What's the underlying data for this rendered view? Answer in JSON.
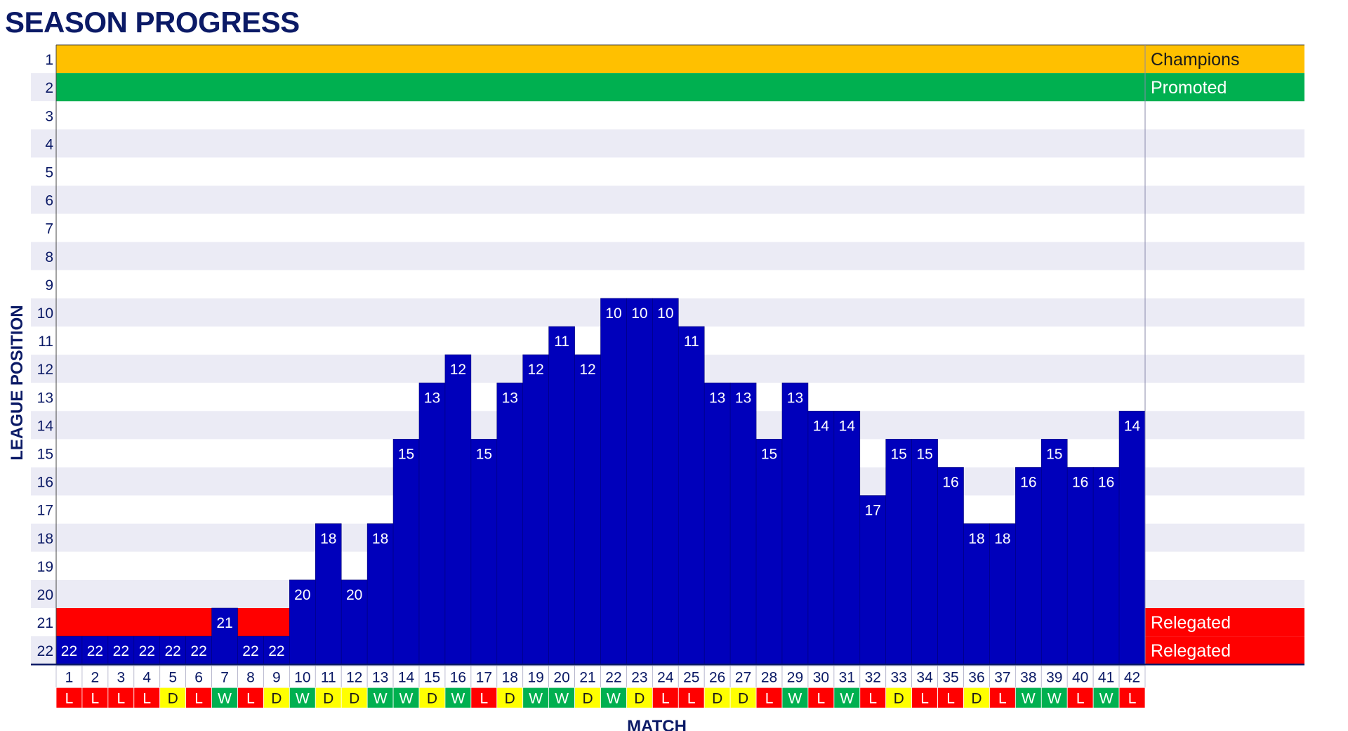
{
  "page": {
    "title": "SEASON PROGRESS"
  },
  "colors": {
    "title": "#0b1a66",
    "bar": "#0000bb",
    "stripe_light": "#ffffff",
    "stripe_dark": "#ebebf5",
    "champions": "#ffc000",
    "promoted": "#00b050",
    "relegated": "#ff0000",
    "result_W": "#00b050",
    "result_D": "#ffff00",
    "result_L": "#ff0000"
  },
  "chart_data": {
    "type": "bar",
    "title": "SEASON PROGRESS",
    "xlabel": "MATCH",
    "ylabel": "LEAGUE POSITION",
    "y_inverted": true,
    "ylim": [
      1,
      22
    ],
    "y_ticks": [
      "1",
      "2",
      "3",
      "4",
      "5",
      "6",
      "7",
      "8",
      "9",
      "10",
      "11",
      "12",
      "13",
      "14",
      "15",
      "16",
      "17",
      "18",
      "19",
      "20",
      "21",
      "22"
    ],
    "categories": [
      "1",
      "2",
      "3",
      "4",
      "5",
      "6",
      "7",
      "8",
      "9",
      "10",
      "11",
      "12",
      "13",
      "14",
      "15",
      "16",
      "17",
      "18",
      "19",
      "20",
      "21",
      "22",
      "23",
      "24",
      "25",
      "26",
      "27",
      "28",
      "29",
      "30",
      "31",
      "32",
      "33",
      "34",
      "35",
      "36",
      "37",
      "38",
      "39",
      "40",
      "41",
      "42"
    ],
    "values": [
      22,
      22,
      22,
      22,
      22,
      22,
      21,
      22,
      22,
      20,
      18,
      20,
      18,
      15,
      13,
      12,
      15,
      13,
      12,
      11,
      12,
      10,
      10,
      10,
      11,
      13,
      13,
      15,
      13,
      14,
      14,
      17,
      15,
      15,
      16,
      18,
      18,
      16,
      15,
      16,
      16,
      14
    ],
    "data_labels": [
      "22",
      "22",
      "22",
      "22",
      "22",
      "22",
      "21",
      "22",
      "22",
      "20",
      "18",
      "20",
      "18",
      "15",
      "13",
      "12",
      "15",
      "13",
      "12",
      "11",
      "12",
      "10",
      "10",
      "10",
      "11",
      "13",
      "13",
      "15",
      "13",
      "14",
      "14",
      "17",
      "15",
      "15",
      "16",
      "18",
      "18",
      "16",
      "15",
      "16",
      "16",
      "14"
    ],
    "results": [
      "L",
      "L",
      "L",
      "L",
      "D",
      "L",
      "W",
      "L",
      "D",
      "W",
      "D",
      "D",
      "W",
      "W",
      "D",
      "W",
      "L",
      "D",
      "W",
      "W",
      "D",
      "W",
      "D",
      "L",
      "L",
      "D",
      "D",
      "L",
      "W",
      "L",
      "W",
      "L",
      "D",
      "L",
      "L",
      "D",
      "L",
      "W",
      "W",
      "L",
      "W",
      "L"
    ],
    "zones": [
      {
        "position": 1,
        "label": "Champions"
      },
      {
        "position": 2,
        "label": "Promoted"
      },
      {
        "position": 21,
        "label": "Relegated"
      },
      {
        "position": 22,
        "label": "Relegated"
      }
    ],
    "grid": false,
    "legend": "right"
  }
}
